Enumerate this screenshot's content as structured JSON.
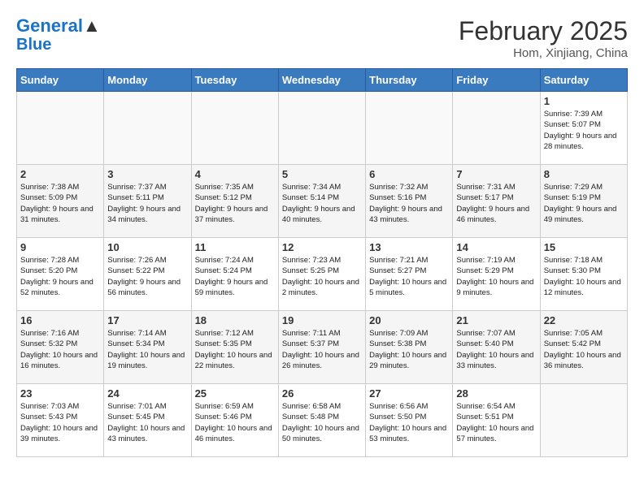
{
  "header": {
    "logo_line1": "General",
    "logo_line2": "Blue",
    "month_year": "February 2025",
    "location": "Hom, Xinjiang, China"
  },
  "weekdays": [
    "Sunday",
    "Monday",
    "Tuesday",
    "Wednesday",
    "Thursday",
    "Friday",
    "Saturday"
  ],
  "weeks": [
    [
      {
        "day": "",
        "info": ""
      },
      {
        "day": "",
        "info": ""
      },
      {
        "day": "",
        "info": ""
      },
      {
        "day": "",
        "info": ""
      },
      {
        "day": "",
        "info": ""
      },
      {
        "day": "",
        "info": ""
      },
      {
        "day": "1",
        "info": "Sunrise: 7:39 AM\nSunset: 5:07 PM\nDaylight: 9 hours\nand 28 minutes."
      }
    ],
    [
      {
        "day": "2",
        "info": "Sunrise: 7:38 AM\nSunset: 5:09 PM\nDaylight: 9 hours\nand 31 minutes."
      },
      {
        "day": "3",
        "info": "Sunrise: 7:37 AM\nSunset: 5:11 PM\nDaylight: 9 hours\nand 34 minutes."
      },
      {
        "day": "4",
        "info": "Sunrise: 7:35 AM\nSunset: 5:12 PM\nDaylight: 9 hours\nand 37 minutes."
      },
      {
        "day": "5",
        "info": "Sunrise: 7:34 AM\nSunset: 5:14 PM\nDaylight: 9 hours\nand 40 minutes."
      },
      {
        "day": "6",
        "info": "Sunrise: 7:32 AM\nSunset: 5:16 PM\nDaylight: 9 hours\nand 43 minutes."
      },
      {
        "day": "7",
        "info": "Sunrise: 7:31 AM\nSunset: 5:17 PM\nDaylight: 9 hours\nand 46 minutes."
      },
      {
        "day": "8",
        "info": "Sunrise: 7:29 AM\nSunset: 5:19 PM\nDaylight: 9 hours\nand 49 minutes."
      }
    ],
    [
      {
        "day": "9",
        "info": "Sunrise: 7:28 AM\nSunset: 5:20 PM\nDaylight: 9 hours\nand 52 minutes."
      },
      {
        "day": "10",
        "info": "Sunrise: 7:26 AM\nSunset: 5:22 PM\nDaylight: 9 hours\nand 56 minutes."
      },
      {
        "day": "11",
        "info": "Sunrise: 7:24 AM\nSunset: 5:24 PM\nDaylight: 9 hours\nand 59 minutes."
      },
      {
        "day": "12",
        "info": "Sunrise: 7:23 AM\nSunset: 5:25 PM\nDaylight: 10 hours\nand 2 minutes."
      },
      {
        "day": "13",
        "info": "Sunrise: 7:21 AM\nSunset: 5:27 PM\nDaylight: 10 hours\nand 5 minutes."
      },
      {
        "day": "14",
        "info": "Sunrise: 7:19 AM\nSunset: 5:29 PM\nDaylight: 10 hours\nand 9 minutes."
      },
      {
        "day": "15",
        "info": "Sunrise: 7:18 AM\nSunset: 5:30 PM\nDaylight: 10 hours\nand 12 minutes."
      }
    ],
    [
      {
        "day": "16",
        "info": "Sunrise: 7:16 AM\nSunset: 5:32 PM\nDaylight: 10 hours\nand 16 minutes."
      },
      {
        "day": "17",
        "info": "Sunrise: 7:14 AM\nSunset: 5:34 PM\nDaylight: 10 hours\nand 19 minutes."
      },
      {
        "day": "18",
        "info": "Sunrise: 7:12 AM\nSunset: 5:35 PM\nDaylight: 10 hours\nand 22 minutes."
      },
      {
        "day": "19",
        "info": "Sunrise: 7:11 AM\nSunset: 5:37 PM\nDaylight: 10 hours\nand 26 minutes."
      },
      {
        "day": "20",
        "info": "Sunrise: 7:09 AM\nSunset: 5:38 PM\nDaylight: 10 hours\nand 29 minutes."
      },
      {
        "day": "21",
        "info": "Sunrise: 7:07 AM\nSunset: 5:40 PM\nDaylight: 10 hours\nand 33 minutes."
      },
      {
        "day": "22",
        "info": "Sunrise: 7:05 AM\nSunset: 5:42 PM\nDaylight: 10 hours\nand 36 minutes."
      }
    ],
    [
      {
        "day": "23",
        "info": "Sunrise: 7:03 AM\nSunset: 5:43 PM\nDaylight: 10 hours\nand 39 minutes."
      },
      {
        "day": "24",
        "info": "Sunrise: 7:01 AM\nSunset: 5:45 PM\nDaylight: 10 hours\nand 43 minutes."
      },
      {
        "day": "25",
        "info": "Sunrise: 6:59 AM\nSunset: 5:46 PM\nDaylight: 10 hours\nand 46 minutes."
      },
      {
        "day": "26",
        "info": "Sunrise: 6:58 AM\nSunset: 5:48 PM\nDaylight: 10 hours\nand 50 minutes."
      },
      {
        "day": "27",
        "info": "Sunrise: 6:56 AM\nSunset: 5:50 PM\nDaylight: 10 hours\nand 53 minutes."
      },
      {
        "day": "28",
        "info": "Sunrise: 6:54 AM\nSunset: 5:51 PM\nDaylight: 10 hours\nand 57 minutes."
      },
      {
        "day": "",
        "info": ""
      }
    ]
  ]
}
